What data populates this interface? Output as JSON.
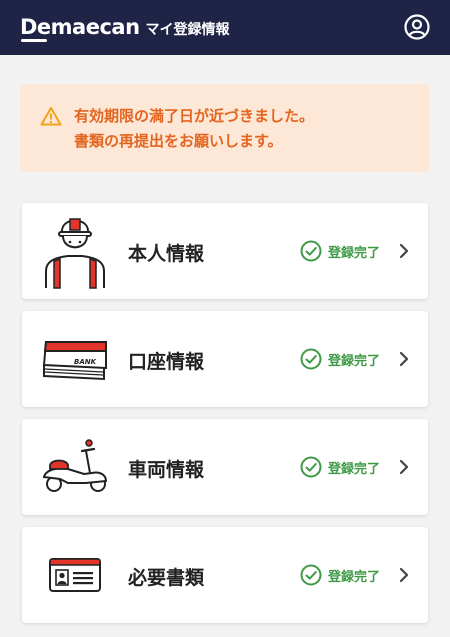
{
  "header": {
    "logo": "Demaecan",
    "title": "マイ登録情報",
    "account_icon": "user-circle-icon"
  },
  "notice": {
    "icon": "warning-triangle-icon",
    "line1": "有効期限の満了日が近づきました。",
    "line2": "書類の再提出をお願いします。",
    "color": "#e3651f",
    "background": "#fde7d6"
  },
  "items": [
    {
      "label": "本人情報",
      "status": "登録完了",
      "illustration": "courier-person-icon"
    },
    {
      "label": "口座情報",
      "status": "登録完了",
      "illustration": "bank-book-icon"
    },
    {
      "label": "車両情報",
      "status": "登録完了",
      "illustration": "scooter-icon"
    },
    {
      "label": "必要書類",
      "status": "登録完了",
      "illustration": "id-card-icon"
    }
  ],
  "colors": {
    "header_bg": "#1f2447",
    "status_green": "#3e9a46",
    "accent_red": "#e2342b"
  }
}
